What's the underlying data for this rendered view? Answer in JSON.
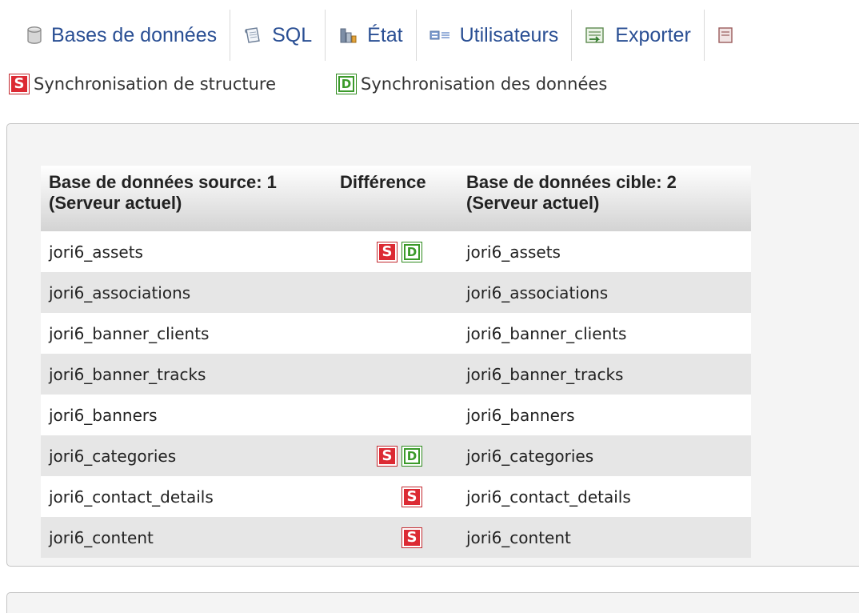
{
  "menu": [
    {
      "label": "Bases de données",
      "icon": "database-icon"
    },
    {
      "label": "SQL",
      "icon": "sql-page-icon"
    },
    {
      "label": "État",
      "icon": "status-chart-icon"
    },
    {
      "label": "Utilisateurs",
      "icon": "users-icon"
    },
    {
      "label": "Exporter",
      "icon": "export-icon"
    }
  ],
  "legend": {
    "structure": {
      "badge": "S",
      "label": "Synchronisation de structure"
    },
    "data": {
      "badge": "D",
      "label": "Synchronisation des données"
    }
  },
  "colors": {
    "structure_badge": "#dc2a33",
    "data_badge": "#3b9a2a",
    "link": "#2a4f94",
    "panel_bg": "#f4f4f4",
    "row_even": "#e6e6e6"
  },
  "table": {
    "headers": {
      "source": "Base de données source: 1\n(Serveur actuel)",
      "source_line1": "Base de données source: 1",
      "source_line2": "(Serveur actuel)",
      "difference": "Différence",
      "target_line1": "Base de données cible: 2",
      "target_line2": "(Serveur actuel)"
    },
    "rows": [
      {
        "source": "jori6_assets",
        "target": "jori6_assets",
        "diff": [
          "S",
          "D"
        ]
      },
      {
        "source": "jori6_associations",
        "target": "jori6_associations",
        "diff": []
      },
      {
        "source": "jori6_banner_clients",
        "target": "jori6_banner_clients",
        "diff": []
      },
      {
        "source": "jori6_banner_tracks",
        "target": "jori6_banner_tracks",
        "diff": []
      },
      {
        "source": "jori6_banners",
        "target": "jori6_banners",
        "diff": []
      },
      {
        "source": "jori6_categories",
        "target": "jori6_categories",
        "diff": [
          "S",
          "D"
        ]
      },
      {
        "source": "jori6_contact_details",
        "target": "jori6_contact_details",
        "diff": [
          "S"
        ]
      },
      {
        "source": "jori6_content",
        "target": "jori6_content",
        "diff": [
          "S"
        ]
      }
    ]
  }
}
